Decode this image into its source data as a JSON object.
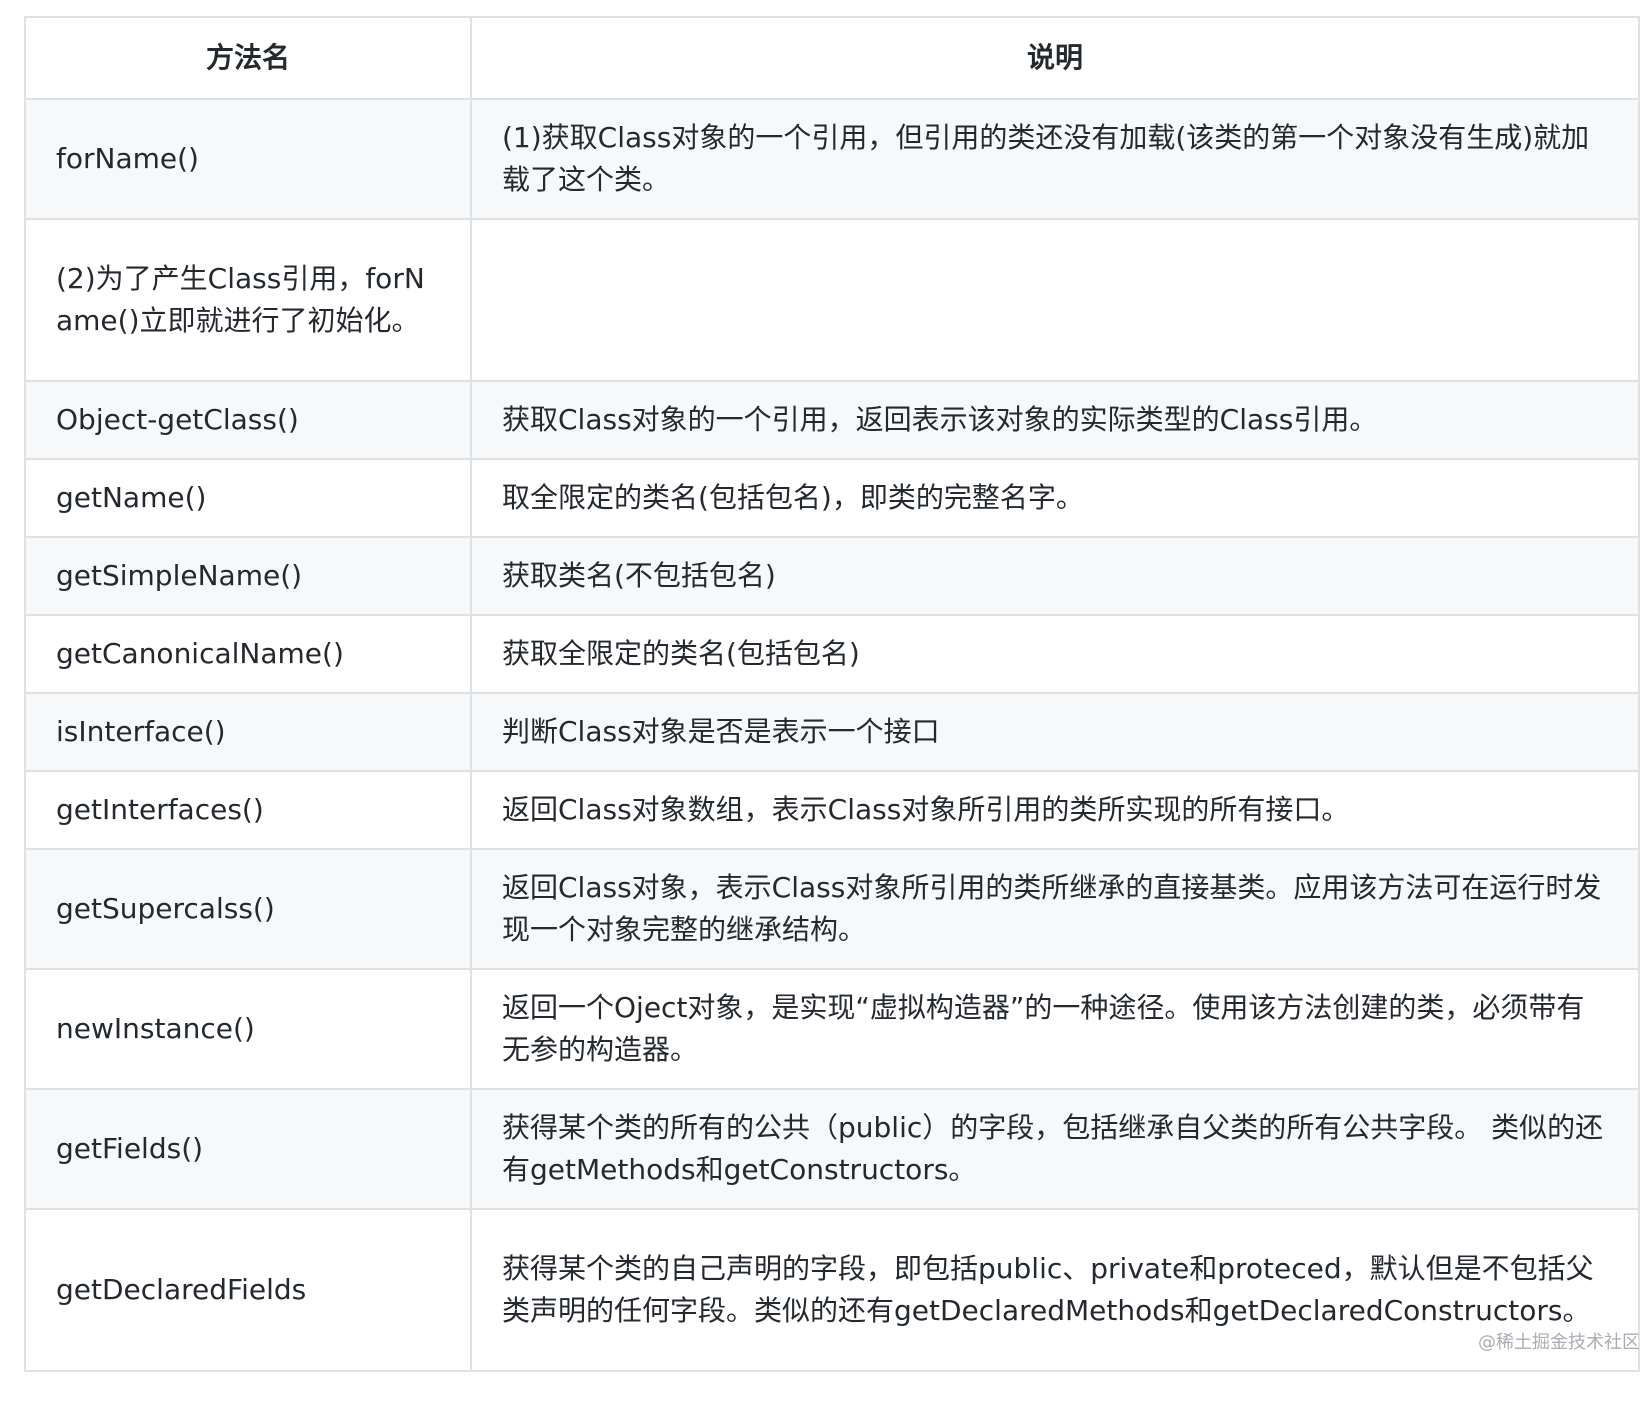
{
  "table": {
    "headers": [
      "方法名",
      "说明"
    ],
    "rows": [
      {
        "method": "forName()",
        "description": "(1)获取Class对象的一个引用，但引用的类还没有加载(该类的第一个对象没有生成)就加载了这个类。"
      },
      {
        "method": "(2)为了产生Class引用，forName()立即就进行了初始化。",
        "description": ""
      },
      {
        "method": "Object-getClass()",
        "description": "获取Class对象的一个引用，返回表示该对象的实际类型的Class引用。"
      },
      {
        "method": "getName()",
        "description": "取全限定的类名(包括包名)，即类的完整名字。"
      },
      {
        "method": "getSimpleName()",
        "description": "获取类名(不包括包名)"
      },
      {
        "method": "getCanonicalName()",
        "description": "获取全限定的类名(包括包名)"
      },
      {
        "method": "isInterface()",
        "description": "判断Class对象是否是表示一个接口"
      },
      {
        "method": "getInterfaces()",
        "description": "返回Class对象数组，表示Class对象所引用的类所实现的所有接口。"
      },
      {
        "method": "getSupercalss()",
        "description": "返回Class对象，表示Class对象所引用的类所继承的直接基类。应用该方法可在运行时发现一个对象完整的继承结构。"
      },
      {
        "method": "newInstance()",
        "description": "返回一个Oject对象，是实现“虚拟构造器”的一种途径。使用该方法创建的类，必须带有无参的构造器。"
      },
      {
        "method": "getFields()",
        "description": "获得某个类的所有的公共（public）的字段，包括继承自父类的所有公共字段。 类似的还有getMethods和getConstructors。"
      },
      {
        "method": "getDeclaredFields",
        "description": "获得某个类的自己声明的字段，即包括public、private和proteced，默认但是不包括父类声明的任何字段。类似的还有getDeclaredMethods和getDeclaredConstructors。"
      }
    ]
  },
  "watermark": "@稀土掘金技术社区"
}
